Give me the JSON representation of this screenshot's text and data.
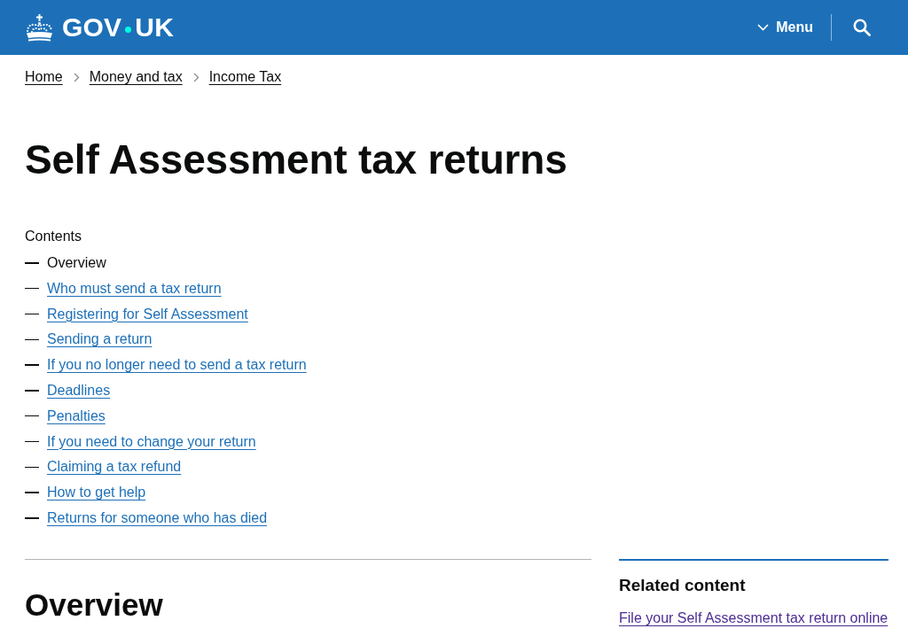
{
  "header": {
    "logo": {
      "text_before_dot": "GOV",
      "text_after_dot": "UK"
    },
    "menu_button": {
      "label": "Menu",
      "expanded": false
    }
  },
  "breadcrumbs": [
    "Home",
    "Money and tax",
    "Income Tax"
  ],
  "title": "Self Assessment tax returns",
  "contents": {
    "heading": "Contents",
    "items": [
      {
        "label": "Overview",
        "selected": true
      },
      {
        "label": "Who must send a tax return",
        "selected": false
      },
      {
        "label": "Registering for Self Assessment",
        "selected": false
      },
      {
        "label": "Sending a return",
        "selected": false
      },
      {
        "label": "If you no longer need to send a tax return",
        "selected": false
      },
      {
        "label": "Deadlines",
        "selected": false
      },
      {
        "label": "Penalties",
        "selected": false
      },
      {
        "label": "If you need to change your return",
        "selected": false
      },
      {
        "label": "Claiming a tax refund",
        "selected": false
      },
      {
        "label": "How to get help",
        "selected": false
      },
      {
        "label": "Returns for someone who has died",
        "selected": false
      }
    ]
  },
  "section": {
    "heading": "Overview"
  },
  "related_content": {
    "heading": "Related content",
    "links": [
      {
        "label": "File your Self Assessment tax return online",
        "visited": true
      }
    ]
  }
}
